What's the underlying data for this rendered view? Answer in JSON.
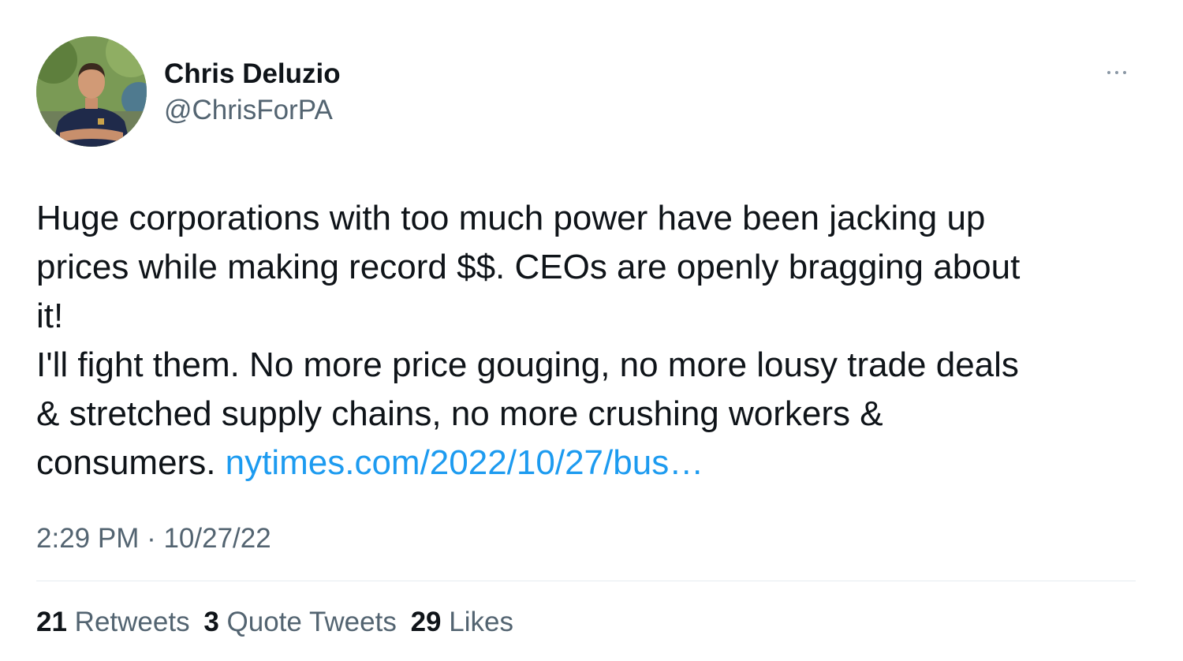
{
  "author": {
    "display_name": "Chris Deluzio",
    "handle": "@ChrisForPA"
  },
  "menu": {
    "icon": "more-horizontal-icon"
  },
  "tweet": {
    "lines": [
      "Huge corporations with too much power have been jacking up",
      "prices while making record $$. CEOs are openly bragging about",
      "it!",
      "I'll fight them. No more price gouging, no more lousy trade deals",
      "& stretched supply chains, no more crushing workers &"
    ],
    "last_line_text": "consumers. ",
    "link_text": "nytimes.com/2022/10/27/bus…",
    "timestamp": "2:29 PM · 10/27/22"
  },
  "stats": {
    "retweets_count": "21",
    "retweets_label": "Retweets",
    "quotes_count": "3",
    "quotes_label": "Quote Tweets",
    "likes_count": "29",
    "likes_label": "Likes"
  },
  "colors": {
    "text_primary": "#0f1419",
    "text_secondary": "#536471",
    "link": "#1d9bf0",
    "divider": "#e6ecf0"
  }
}
